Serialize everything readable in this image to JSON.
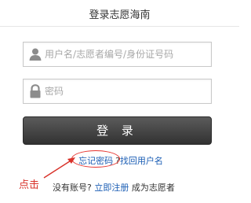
{
  "header": {
    "title": "登录志愿海南"
  },
  "form": {
    "user_placeholder": "用户名/志愿者编号/身份证号码",
    "password_placeholder": "密码",
    "login_label": "登 录"
  },
  "links": {
    "forgot_password": "忘记密码",
    "separator": "?",
    "find_username": "找回用户名"
  },
  "annotation": {
    "hint": "点击",
    "color": "#d8322a"
  },
  "register": {
    "prefix": "没有账号?",
    "link": "立即注册",
    "suffix": "成为志愿者"
  },
  "icons": {
    "user": "user-icon",
    "password": "lock-icon"
  }
}
